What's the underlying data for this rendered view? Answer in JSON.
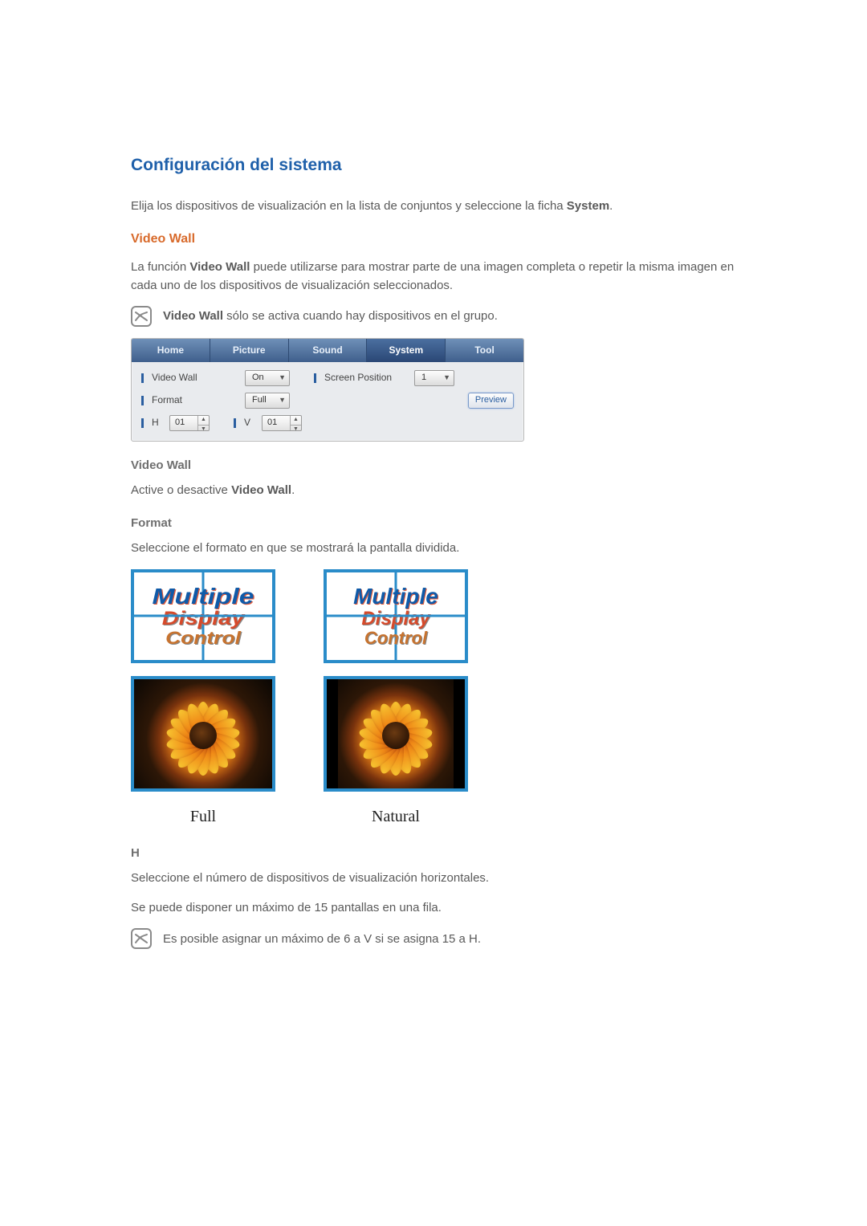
{
  "h1": "Configuración del sistema",
  "intro_a": "Elija los dispositivos de visualización en la lista de conjuntos y seleccione la ficha ",
  "intro_b": "System",
  "intro_c": ".",
  "h2_videowall": "Video Wall",
  "vw_p1_a": "La función ",
  "vw_p1_b": "Video Wall",
  "vw_p1_c": " puede utilizarse para mostrar parte de una imagen completa o repetir la misma imagen en cada uno de los dispositivos de visualización seleccionados.",
  "note1_a": "Video Wall",
  "note1_b": " sólo se activa cuando hay dispositivos en el grupo.",
  "tabs": {
    "home": "Home",
    "picture": "Picture",
    "sound": "Sound",
    "system": "System",
    "tool": "Tool"
  },
  "panel": {
    "video_wall_label": "Video Wall",
    "video_wall_value": "On",
    "screen_position_label": "Screen Position",
    "screen_position_value": "1",
    "format_label": "Format",
    "format_value": "Full",
    "h_label": "H",
    "h_value": "01",
    "v_label": "V",
    "v_value": "01",
    "preview": "Preview"
  },
  "h3_video_wall": "Video Wall",
  "vw_toggle_a": "Active o desactive ",
  "vw_toggle_b": "Video Wall",
  "vw_toggle_c": ".",
  "h3_format": "Format",
  "format_desc": "Seleccione el formato en que se mostrará la pantalla dividida.",
  "tile_text": {
    "l1": "Multiple",
    "l2": "Display",
    "l3": "Control"
  },
  "captions": {
    "full": "Full",
    "natural": "Natural"
  },
  "h3_h": "H",
  "h_desc1": "Seleccione el número de dispositivos de visualización horizontales.",
  "h_desc2": "Se puede disponer un máximo de 15 pantallas en una fila.",
  "note2": "Es posible asignar un máximo de 6 a V si se asigna 15 a H."
}
